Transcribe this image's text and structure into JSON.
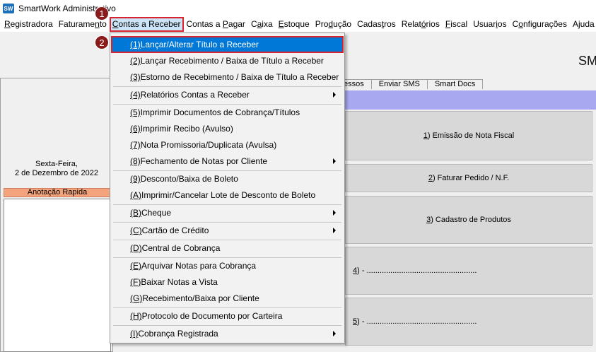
{
  "window": {
    "title": "SmartWork Administrativo",
    "icon": "sw-logo-icon"
  },
  "menubar": [
    {
      "pre": "",
      "u": "R",
      "post": "egistradora"
    },
    {
      "pre": "Faturame",
      "u": "n",
      "post": "to"
    },
    {
      "pre": "",
      "u": "C",
      "post": "ontas a Receber"
    },
    {
      "pre": "Contas a ",
      "u": "P",
      "post": "agar"
    },
    {
      "pre": "C",
      "u": "a",
      "post": "ixa"
    },
    {
      "pre": "",
      "u": "E",
      "post": "stoque"
    },
    {
      "pre": "Pro",
      "u": "d",
      "post": "ução"
    },
    {
      "pre": "Cadas",
      "u": "t",
      "post": "ros"
    },
    {
      "pre": "Relat",
      "u": "ó",
      "post": "rios"
    },
    {
      "pre": "",
      "u": "F",
      "post": "iscal"
    },
    {
      "pre": "Usuar",
      "u": "i",
      "post": "os"
    },
    {
      "pre": "C",
      "u": "o",
      "post": "nfigurações"
    },
    {
      "pre": "Ajuda",
      "u": "",
      "post": ""
    }
  ],
  "steps": {
    "one": "1",
    "two": "2"
  },
  "dropdown": [
    {
      "pre": "",
      "u": "(1) ",
      "post": "Lançar/Alterar Título a Receber"
    },
    {
      "pre": "",
      "u": "(2)",
      "post": " Lançar Recebimento / Baixa de Título a Receber"
    },
    {
      "pre": "",
      "u": "(3)",
      "post": " Estorno de Recebimento / Baixa de Título a Receber"
    },
    {
      "pre": "",
      "u": "(4)",
      "post": " Relatórios Contas a Receber"
    },
    {
      "pre": "",
      "u": "(5)",
      "post": " Imprimir Documentos de Cobrança/Títulos"
    },
    {
      "pre": "",
      "u": "(6)",
      "post": " Imprimir Recibo (Avulso)"
    },
    {
      "pre": "",
      "u": "(7)",
      "post": " Nota Promissoria/Duplicata (Avulsa)"
    },
    {
      "pre": "",
      "u": "(8)",
      "post": " Fechamento de Notas por Cliente"
    },
    {
      "pre": "",
      "u": "(9)",
      "post": " Desconto/Baixa de Boleto"
    },
    {
      "pre": "",
      "u": "(A)",
      "post": " Imprimir/Cancelar Lote de Desconto de Boleto"
    },
    {
      "pre": "",
      "u": "(B)",
      "post": " Cheque"
    },
    {
      "pre": "",
      "u": "(C)",
      "post": " Cartão de Crédito"
    },
    {
      "pre": "",
      "u": "(D)",
      "post": " Central de Cobrança"
    },
    {
      "pre": "",
      "u": "(E)",
      "post": " Arquivar Notas para Cobrança"
    },
    {
      "pre": "",
      "u": "(F)",
      "post": " Baixar Notas a Vista"
    },
    {
      "pre": "",
      "u": "(G)",
      "post": " Recebimento/Baixa por Cliente"
    },
    {
      "pre": "",
      "u": "(H)",
      "post": " Protocolo de Documento por Carteira"
    },
    {
      "pre": "",
      "u": "(I)",
      "post": " Cobrança Registrada"
    }
  ],
  "workspace": {
    "brand_text": "SM",
    "date_day": "Sexta-Feira,",
    "date_full": "2 de Dezembro de 2022",
    "note_label": "Anotação Rapida",
    "tabs": [
      "essos",
      "Enviar SMS",
      "Smart Docs"
    ],
    "shortcuts": [
      {
        "u": "1",
        "post": ") Emissão de Nota Fiscal"
      },
      {
        "u": "2",
        "post": ") Faturar Pedido / N.F."
      },
      {
        "u": "3",
        "post": ") Cadastro de Produtos"
      },
      {
        "u": "4",
        "post": ") - ..................................................."
      },
      {
        "u": "5",
        "post": ") - ..................................................."
      }
    ]
  }
}
